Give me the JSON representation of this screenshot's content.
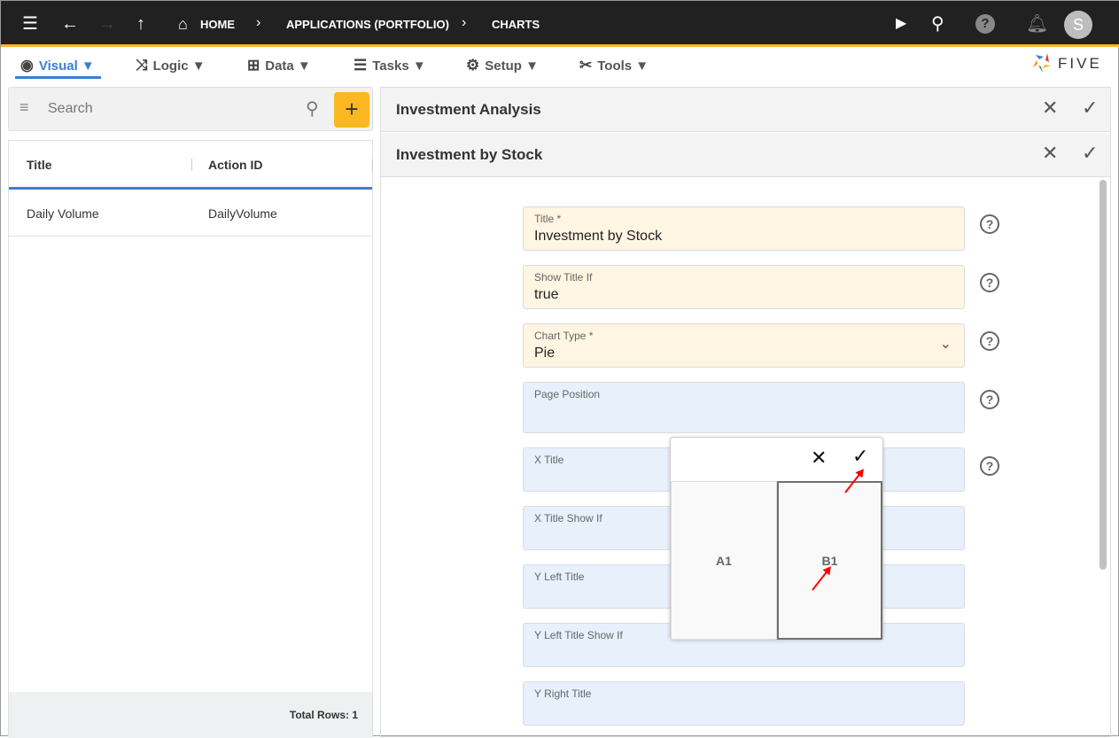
{
  "topbar": {
    "breadcrumbs": [
      "HOME",
      "APPLICATIONS (PORTFOLIO)",
      "CHARTS"
    ],
    "avatar_letter": "S",
    "accent": "#f9b822"
  },
  "menu": [
    {
      "label": "Visual ▼",
      "icon": "eye-icon"
    },
    {
      "label": "Logic ▼",
      "icon": "logic-icon"
    },
    {
      "label": "Data ▼",
      "icon": "table-icon"
    },
    {
      "label": "Tasks ▼",
      "icon": "tasks-icon"
    },
    {
      "label": "Setup ▼",
      "icon": "gear-icon"
    },
    {
      "label": "Tools ▼",
      "icon": "tools-icon"
    }
  ],
  "brand": "FIVE",
  "left": {
    "search_placeholder": "Search",
    "columns": [
      "Title",
      "Action ID"
    ],
    "rows": [
      [
        "Daily Volume",
        "DailyVolume"
      ]
    ],
    "total_rows": "Total Rows: 1"
  },
  "right": {
    "panel1_title": "Investment Analysis",
    "panel2_title": "Investment by Stock",
    "fields": [
      {
        "label": "Title *",
        "value": "Investment by Stock"
      },
      {
        "label": "Show Title If",
        "value": "true"
      },
      {
        "label": "Chart Type *",
        "value": "Pie"
      },
      {
        "label": "Page Position",
        "value": ""
      },
      {
        "label": "X Title",
        "value": ""
      },
      {
        "label": "X Title Show If",
        "value": ""
      },
      {
        "label": "Y Left Title",
        "value": ""
      },
      {
        "label": "Y Left Title Show If",
        "value": ""
      },
      {
        "label": "Y Right Title",
        "value": ""
      }
    ]
  },
  "popup": {
    "cells": [
      "A1",
      "B1"
    ],
    "selected": "B1"
  }
}
